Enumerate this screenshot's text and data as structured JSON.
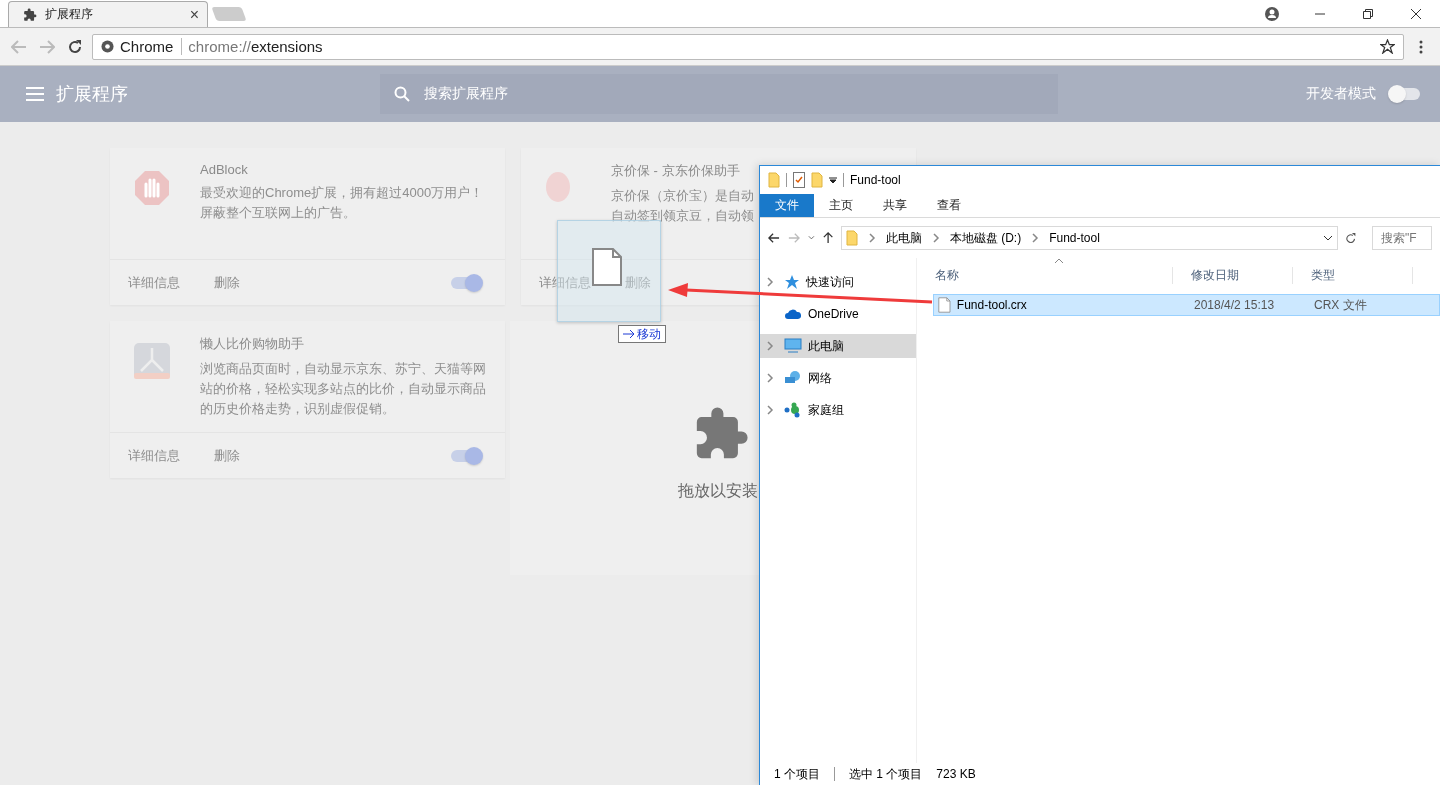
{
  "browser": {
    "tab": {
      "title": "扩展程序",
      "close": "×"
    },
    "address": {
      "site": "Chrome",
      "scheme": "chrome://",
      "path": "extensions"
    }
  },
  "extensions_page": {
    "title": "扩展程序",
    "search": {
      "placeholder": "搜索扩展程序"
    },
    "dev_mode": {
      "label": "开发者模式",
      "on": false
    },
    "cards": [
      {
        "kind": "adblock",
        "name": "AdBlock",
        "description": "最受欢迎的Chrome扩展，拥有超过4000万用户！屏蔽整个互联网上的广告。",
        "details": "详细信息",
        "remove": "删除",
        "enabled": true
      },
      {
        "kind": "jjb",
        "name": "京价保 - 京东价保助手",
        "description": "京价保（京价宝）是自动自动签到领京豆，自动领",
        "details": "详细信息",
        "remove": "删除"
      },
      {
        "kind": "lazy",
        "name": "懒人比价购物助手",
        "description": "浏览商品页面时，自动显示京东、苏宁、天猫等网站的价格，轻松实现多站点的比价，自动显示商品的历史价格走势，识别虚假促销。",
        "details": "详细信息",
        "remove": "删除",
        "enabled": true
      }
    ],
    "drop_zone": {
      "label": "拖放以安装"
    }
  },
  "drag": {
    "effect": "移动"
  },
  "explorer": {
    "title": "Fund-tool",
    "ribbon_tabs": [
      {
        "label": "文件",
        "kind": "file"
      },
      {
        "label": "主页",
        "kind": "tab"
      },
      {
        "label": "共享",
        "kind": "tab"
      },
      {
        "label": "查看",
        "kind": "tab"
      }
    ],
    "breadcrumb": [
      "此电脑",
      "本地磁盘 (D:)",
      "Fund-tool"
    ],
    "search": {
      "placeholder": "搜索\"F"
    },
    "nav": [
      {
        "label": "快速访问",
        "kind": "star",
        "expandable": true,
        "selected": false
      },
      {
        "label": "OneDrive",
        "kind": "cloud",
        "expandable": false,
        "selected": false
      },
      {
        "label": "此电脑",
        "kind": "pc",
        "expandable": true,
        "selected": true
      },
      {
        "label": "网络",
        "kind": "network",
        "expandable": true,
        "selected": false
      },
      {
        "label": "家庭组",
        "kind": "homegroup",
        "expandable": true,
        "selected": false
      }
    ],
    "columns": [
      "名称",
      "修改日期",
      "类型"
    ],
    "files": [
      {
        "name": "Fund-tool.crx",
        "modified": "2018/4/2 15:13",
        "type": "CRX 文件",
        "selected": true
      }
    ],
    "status": {
      "count": "1 个项目",
      "selection": "选中 1 个项目",
      "size": "723 KB"
    }
  }
}
